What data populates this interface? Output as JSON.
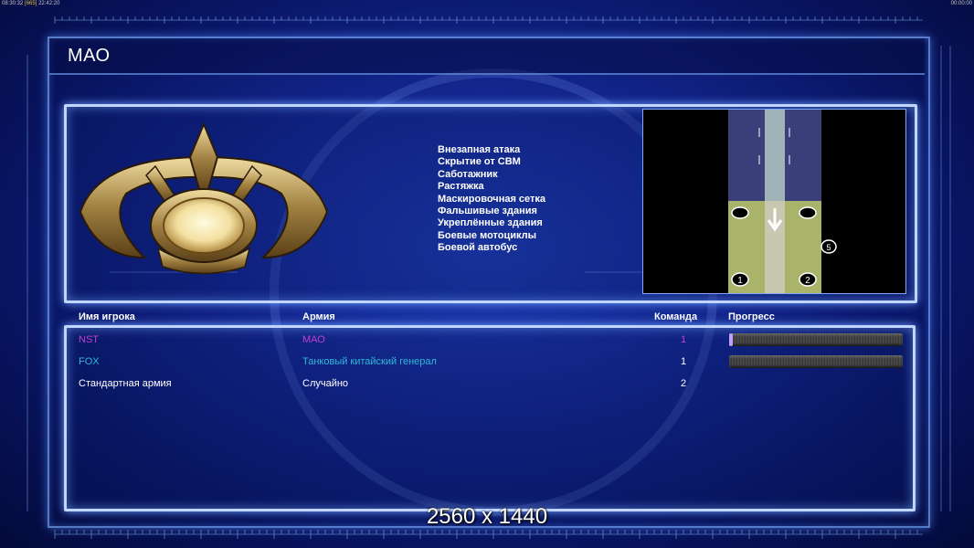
{
  "topbar": {
    "left_clock": "08:30:32",
    "left_ms": "[665]",
    "left_time": "22:42:20",
    "right_clock": "00:00:00"
  },
  "title": "МАО",
  "rules": [
    "Внезапная атака",
    "Скрытие от СВМ",
    "Саботажник",
    "Растяжка",
    "Маскировочная сетка",
    "Фальшивые здания",
    "Укреплённые здания",
    "Боевые мотоциклы",
    "Боевой автобус"
  ],
  "minimap": {
    "start_positions": [
      "1",
      "2",
      "5"
    ]
  },
  "columns": {
    "player": "Имя игрока",
    "army": "Армия",
    "team": "Команда",
    "progress": "Прогресс"
  },
  "players": [
    {
      "name": "NST",
      "army": "МАО",
      "team": "1",
      "color": "#c040d0",
      "progress": 0.02
    },
    {
      "name": "FOX",
      "army": "Танковый китайский генерал",
      "team": "1",
      "color": "#30b8d8",
      "progress": 0
    },
    {
      "name": "Стандартная армия",
      "army": "Случайно",
      "team": "2",
      "color": "#ffffff",
      "progress": null
    }
  ],
  "resolution_label": "2560 x 1440",
  "colors": {
    "panel_border": "#c0d6ff",
    "background": "#12248a",
    "badge_gold": "#c8a860"
  }
}
